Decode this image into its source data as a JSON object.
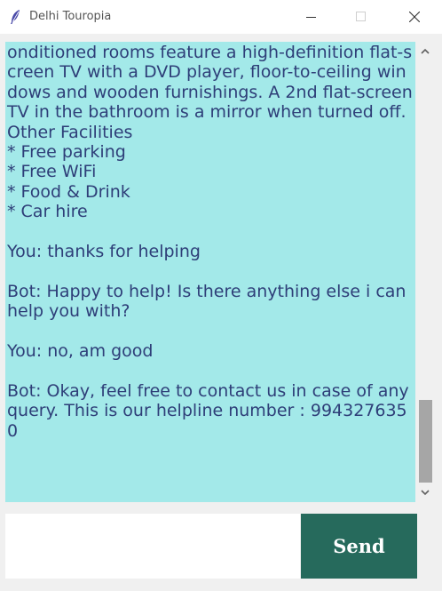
{
  "window": {
    "title": "Delhi Touropia",
    "icons": {
      "app": "feather-icon",
      "minimize": "minimize-icon",
      "maximize": "maximize-icon",
      "close": "close-icon"
    }
  },
  "chat": {
    "transcript": "onditioned rooms feature a high-definition flat-screen TV with a DVD player, floor-to-ceiling windows and wooden furnishings. A 2nd flat-screen TV in the bathroom is a mirror when turned off.\nOther Facilities\n* Free parking\n* Free WiFi\n* Food & Drink\n* Car hire\n\nYou: thanks for helping\n\nBot: Happy to help! Is there anything else i can help you with?\n\nYou: no, am good\n\nBot: Okay, feel free to contact us in case of any query. This is our helpline number : 9943276350",
    "background_color": "#a3e9e9",
    "text_color": "#2e3e78"
  },
  "scrollbar": {
    "up_icon": "chevron-up-icon",
    "down_icon": "chevron-down-icon"
  },
  "input": {
    "value": "",
    "placeholder": ""
  },
  "send_button": {
    "label": "Send",
    "color": "#266a5c"
  }
}
